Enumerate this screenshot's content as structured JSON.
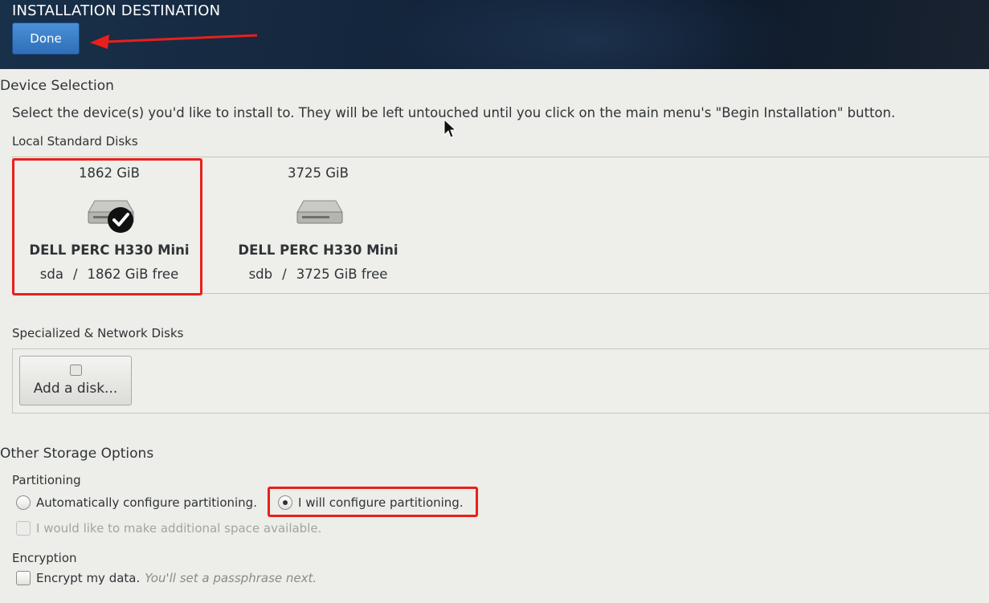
{
  "header": {
    "title": "INSTALLATION DESTINATION",
    "done_label": "Done"
  },
  "device_selection": {
    "title": "Device Selection",
    "description": "Select the device(s) you'd like to install to.  They will be left untouched until you click on the main menu's \"Begin Installation\" button.",
    "local_disks": {
      "title": "Local Standard Disks",
      "disks": [
        {
          "size": "1862 GiB",
          "name": "DELL PERC H330 Mini",
          "device": "sda",
          "separator": "/",
          "free": "1862 GiB free",
          "selected": true
        },
        {
          "size": "3725 GiB",
          "name": "DELL PERC H330 Mini",
          "device": "sdb",
          "separator": "/",
          "free": "3725 GiB free",
          "selected": false
        }
      ]
    },
    "network_disks": {
      "title": "Specialized & Network Disks",
      "add_label": "Add a disk..."
    }
  },
  "storage_options": {
    "title": "Other Storage Options",
    "partitioning": {
      "title": "Partitioning",
      "auto_label": "Automatically configure partitioning.",
      "manual_label": "I will configure partitioning.",
      "selected": "manual",
      "extra_space_label": "I would like to make additional space available."
    },
    "encryption": {
      "title": "Encryption",
      "encrypt_label": "Encrypt my data.",
      "encrypt_hint": "You'll set a passphrase next."
    }
  },
  "colors": {
    "accent": "#3b7fcc",
    "highlight": "#e8201c",
    "header_bg": "#13243a"
  }
}
